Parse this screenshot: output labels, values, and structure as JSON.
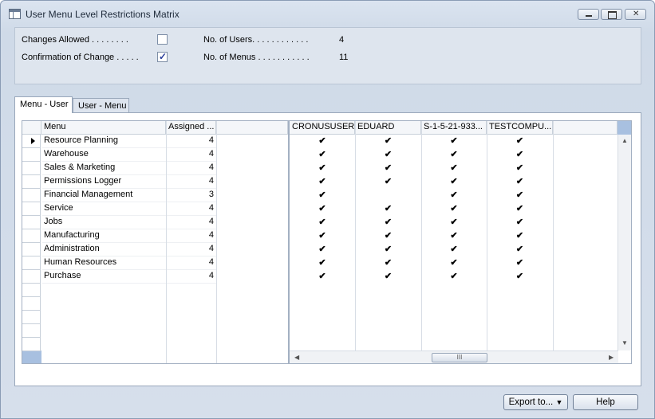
{
  "window": {
    "title": "User Menu Level Restrictions Matrix"
  },
  "header": {
    "changes_allowed_label": "Changes Allowed . . . . . . . .",
    "changes_allowed": false,
    "confirmation_label": "Confirmation of Change . . . . .",
    "confirmation": true,
    "num_users_label": "No. of Users. . . . . . . . . . . .",
    "num_users": "4",
    "num_menus_label": "No. of Menus . . . . . . . . . . .",
    "num_menus": "11"
  },
  "tabs": [
    {
      "label": "Menu - User"
    },
    {
      "label": "User - Menu"
    }
  ],
  "grid": {
    "columns": {
      "menu": "Menu",
      "assigned": "Assigned ..."
    },
    "user_columns": [
      "CRONUSUSER",
      "EDUARD",
      "S-1-5-21-933...",
      "TESTCOMPU..."
    ],
    "rows": [
      {
        "menu": "Resource Planning",
        "assigned": "4",
        "checks": [
          true,
          true,
          true,
          true
        ]
      },
      {
        "menu": "Warehouse",
        "assigned": "4",
        "checks": [
          true,
          true,
          true,
          true
        ]
      },
      {
        "menu": "Sales & Marketing",
        "assigned": "4",
        "checks": [
          true,
          true,
          true,
          true
        ]
      },
      {
        "menu": "Permissions Logger",
        "assigned": "4",
        "checks": [
          true,
          true,
          true,
          true
        ]
      },
      {
        "menu": "Financial Management",
        "assigned": "3",
        "checks": [
          true,
          false,
          true,
          true
        ]
      },
      {
        "menu": "Service",
        "assigned": "4",
        "checks": [
          true,
          true,
          true,
          true
        ]
      },
      {
        "menu": "Jobs",
        "assigned": "4",
        "checks": [
          true,
          true,
          true,
          true
        ]
      },
      {
        "menu": "Manufacturing",
        "assigned": "4",
        "checks": [
          true,
          true,
          true,
          true
        ]
      },
      {
        "menu": "Administration",
        "assigned": "4",
        "checks": [
          true,
          true,
          true,
          true
        ]
      },
      {
        "menu": "Human Resources",
        "assigned": "4",
        "checks": [
          true,
          true,
          true,
          true
        ]
      },
      {
        "menu": "Purchase",
        "assigned": "4",
        "checks": [
          true,
          true,
          true,
          true
        ]
      }
    ],
    "empty_rows": 5,
    "check_glyph": "✔",
    "scroll_thumb_glyph": "III"
  },
  "buttons": {
    "export": "Export to...",
    "help": "Help"
  }
}
